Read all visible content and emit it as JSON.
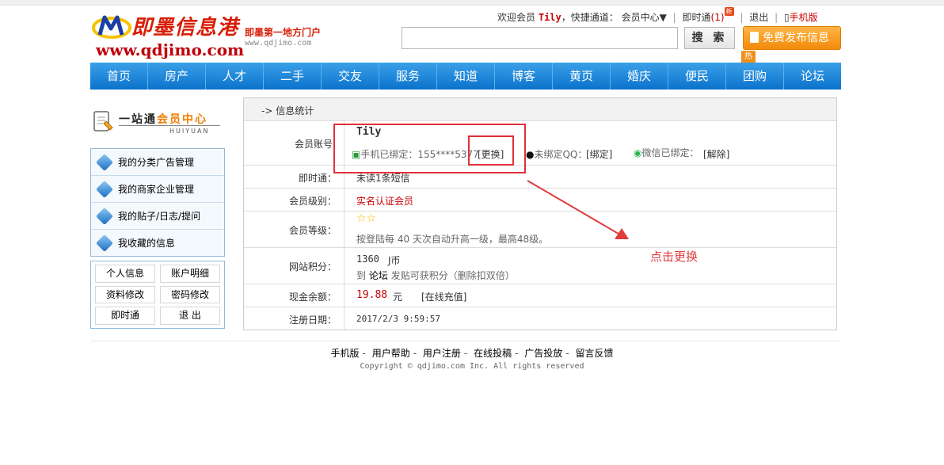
{
  "header": {
    "logo_text": "即墨信息港",
    "logo_url": "www.qdjimo.com",
    "slogan": "即墨第一地方门户",
    "slogan_url": "www.qdjimo.com",
    "welcome_prefix": "欢迎会员",
    "username": "Tily",
    "welcome_suffix": "，快捷通道：",
    "member_center": "会员中心▼",
    "instant": "即时通",
    "instant_count": "(1)",
    "new_badge": "新",
    "logout": "退出",
    "mobile": "手机版",
    "search_placeholder": "",
    "search_button": "搜 索",
    "post_button": "免费发布信息",
    "hot_badge": "热"
  },
  "nav": [
    "首页",
    "房产",
    "人才",
    "二手",
    "交友",
    "服务",
    "知道",
    "博客",
    "黄页",
    "婚庆",
    "便民",
    "团购",
    "论坛"
  ],
  "sidebar": {
    "title_a": "一站通",
    "title_b": "会员中心",
    "subtitle": "HUIYUAN",
    "menu": [
      "我的分类广告管理",
      "我的商家企业管理",
      "我的贴子/日志/提问",
      "我收藏的信息"
    ],
    "links": [
      "个人信息",
      "账户明细",
      "资料修改",
      "密码修改",
      "即时通",
      "退 出"
    ]
  },
  "main": {
    "title": "-> 信息统计",
    "rows": {
      "account_label": "会员账号",
      "account_name": "Tily",
      "phone_text": "手机已绑定：155****5377",
      "phone_change": "[更换]",
      "qq_text": "未绑定QQ：",
      "qq_bind": "[绑定]",
      "wechat_text": "微信已绑定：",
      "wechat_unbind": "[解除]",
      "instant_label": "即时通：",
      "instant_value": "未读1条短信",
      "level_label": "会员级别：",
      "level_value": "实名认证会员",
      "grade_label": "会员等级：",
      "grade_stars": "☆☆",
      "grade_note": "按登陆每 40 天次自动升高一级，最高48级。",
      "points_label": "网站积分：",
      "points_value": "1360",
      "points_unit": "J币",
      "points_note_a": "到",
      "points_note_link": "论坛",
      "points_note_b": "发贴可获积分（删除扣双倍）",
      "cash_label": "现金余额：",
      "cash_value": "19.88",
      "cash_unit": "元",
      "cash_recharge": "[在线充值]",
      "reg_label": "注册日期：",
      "reg_value": "2017/2/3 9:59:57"
    }
  },
  "annotation": "点击更换",
  "footer": {
    "links": [
      "手机版",
      "用户帮助",
      "用户注册",
      "在线投稿",
      "广告投放",
      "留言反馈"
    ],
    "copyright": "Copyright ©  qdjimo.com Inc. All rights reserved"
  },
  "colors": {
    "nav_blue": "#0b72cc",
    "accent_red": "#c00",
    "post_orange": "#f28a0a",
    "annotation_red": "#e03c3c"
  }
}
